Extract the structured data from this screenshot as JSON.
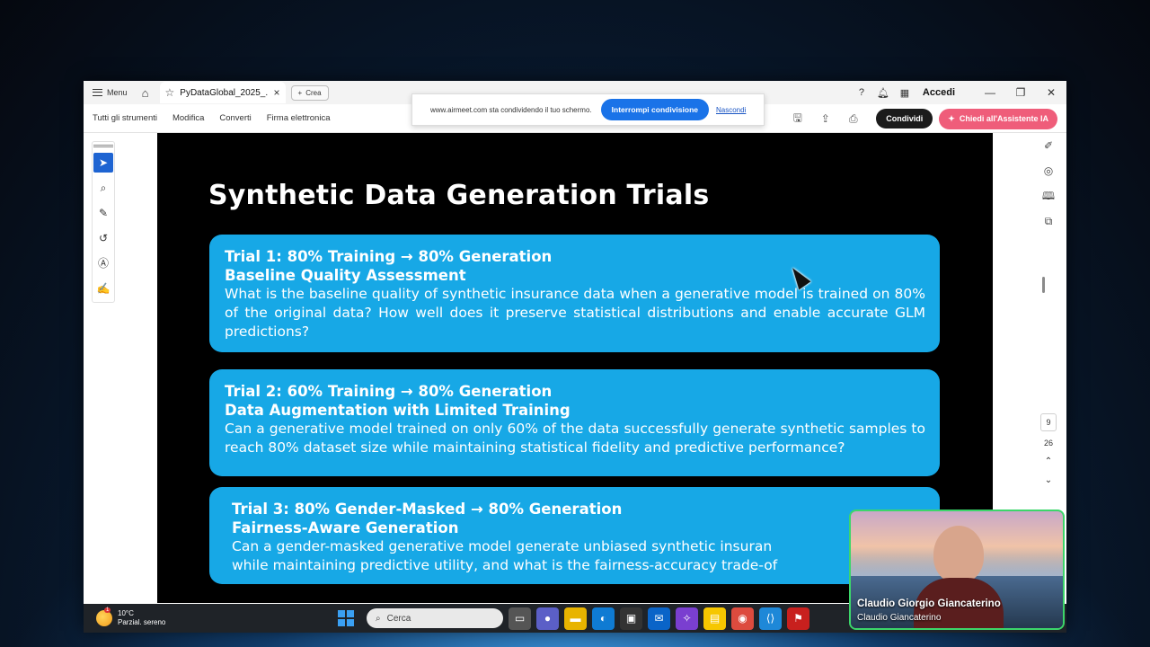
{
  "titlebar": {
    "menu_label": "Menu",
    "tab_title": "PyDataGlobal_2025_...",
    "new_label": "Crea",
    "signin_label": "Accedi"
  },
  "toolbar": {
    "items": [
      "Tutti gli strumenti",
      "Modifica",
      "Converti",
      "Firma elettronica"
    ],
    "share_label": "Condividi",
    "ai_label": "Chiedi all'Assistente IA"
  },
  "share_banner": {
    "text": "www.airmeet.com sta condividendo il tuo schermo.",
    "stop_label": "Interrompi condivisione",
    "hide_label": "Nascondi"
  },
  "slide": {
    "title": "Synthetic Data Generation Trials",
    "trials": [
      {
        "heading": "Trial 1: 80% Training → 80% Generation",
        "subheading": "Baseline Quality Assessment",
        "body": "What is the baseline quality of synthetic insurance data when a generative model is trained on 80% of the original data? How well does it preserve statistical distributions and enable accurate GLM predictions?"
      },
      {
        "heading": "Trial 2: 60% Training → 80% Generation",
        "subheading": "Data Augmentation with Limited Training",
        "body": "Can a generative model trained on only 60% of the data successfully generate synthetic samples to reach 80% dataset size while maintaining statistical fidelity and predictive performance?"
      },
      {
        "heading": "Trial 3: 80% Gender-Masked → 80% Generation",
        "subheading": "Fairness-Aware Generation",
        "body_line1": "Can a gender-masked generative model generate unbiased synthetic insuran",
        "body_line2": "while maintaining predictive utility, and what is the fairness-accuracy trade-of"
      }
    ]
  },
  "page_nav": {
    "current": "9",
    "total": "26"
  },
  "taskbar": {
    "weather_temp": "10°C",
    "weather_desc": "Parzial. sereno",
    "weather_badge": "1",
    "search_placeholder": "Cerca"
  },
  "webcam": {
    "name": "Claudio Giorgio Giancaterino",
    "subname": "Claudio Giancaterino"
  },
  "colors": {
    "trial_box": "#17a8e6",
    "stop_button": "#1a73e8",
    "ai_button": "#ef5d7a",
    "webcam_border": "#3cd66a"
  }
}
